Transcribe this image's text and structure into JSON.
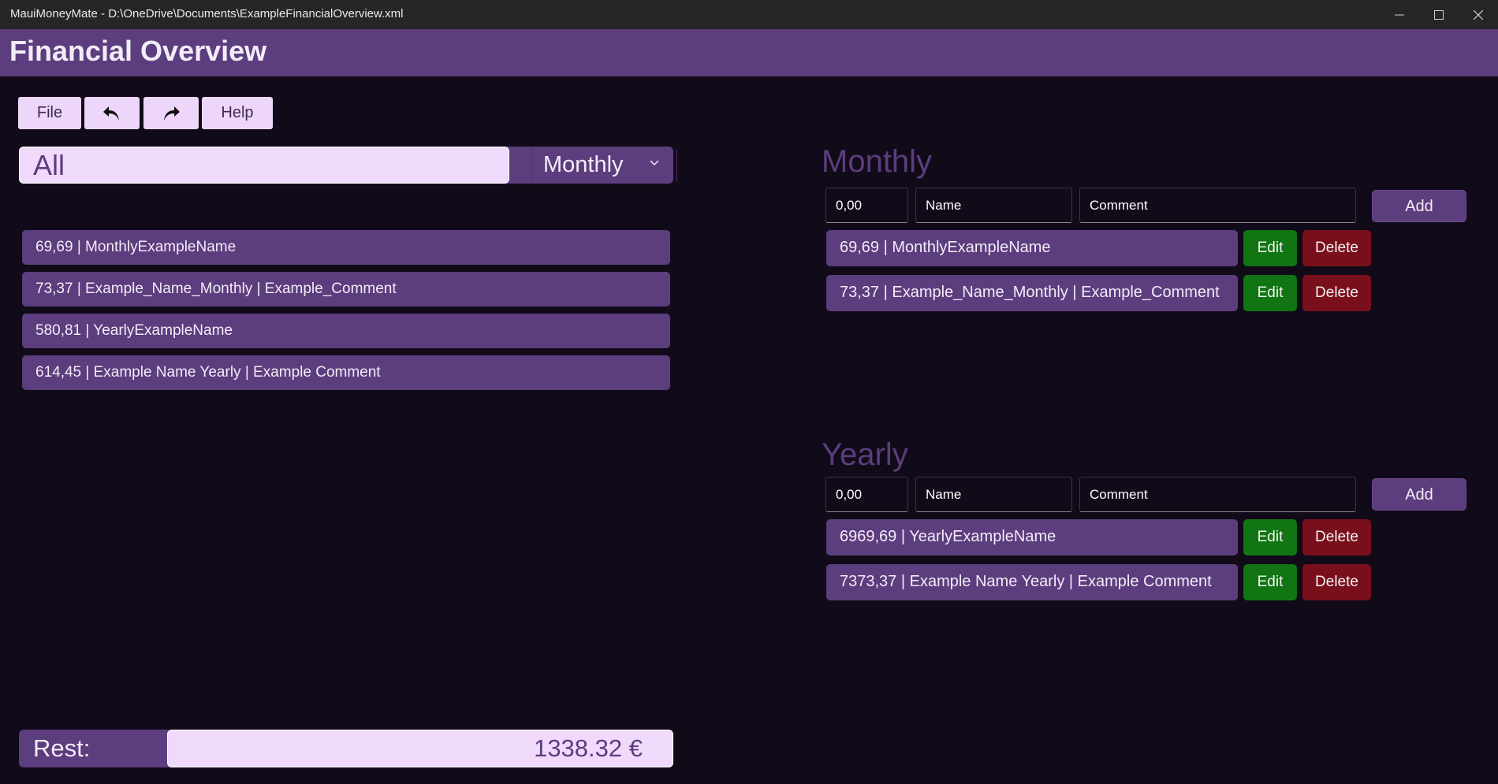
{
  "window": {
    "title": "MauiMoneyMate - D:\\OneDrive\\Documents\\ExampleFinancialOverview.xml"
  },
  "header": {
    "title": "Financial Overview"
  },
  "toolbar": {
    "file_label": "File",
    "undo_icon": "undo-arrow",
    "redo_icon": "redo-arrow",
    "help_label": "Help"
  },
  "filter": {
    "search_value": "All",
    "period_selected": "Monthly"
  },
  "left_list": {
    "items": [
      "69,69 | MonthlyExampleName",
      "73,37 | Example_Name_Monthly  | Example_Comment",
      "580,81 | YearlyExampleName",
      "614,45 | Example Name Yearly  | Example Comment"
    ]
  },
  "rest": {
    "label": "Rest:",
    "value": "1338.32 €"
  },
  "monthly": {
    "title": "Monthly",
    "amount_value": "0,00",
    "name_placeholder": "Name",
    "comment_placeholder": "Comment",
    "add_label": "Add",
    "entries": [
      {
        "text": "69,69 | MonthlyExampleName",
        "edit": "Edit",
        "delete": "Delete"
      },
      {
        "text": "73,37 | Example_Name_Monthly  | Example_Comment",
        "edit": "Edit",
        "delete": "Delete"
      }
    ]
  },
  "yearly": {
    "title": "Yearly",
    "amount_value": "0,00",
    "name_placeholder": "Name",
    "comment_placeholder": "Comment",
    "add_label": "Add",
    "entries": [
      {
        "text": "6969,69 | YearlyExampleName",
        "edit": "Edit",
        "delete": "Delete"
      },
      {
        "text": "7373,37 | Example Name Yearly  | Example Comment",
        "edit": "Edit",
        "delete": "Delete"
      }
    ]
  },
  "colors": {
    "accent": "#5c3d7d",
    "light": "#efdafc",
    "background": "#110b19",
    "edit": "#107512",
    "delete": "#7a0f1c"
  }
}
